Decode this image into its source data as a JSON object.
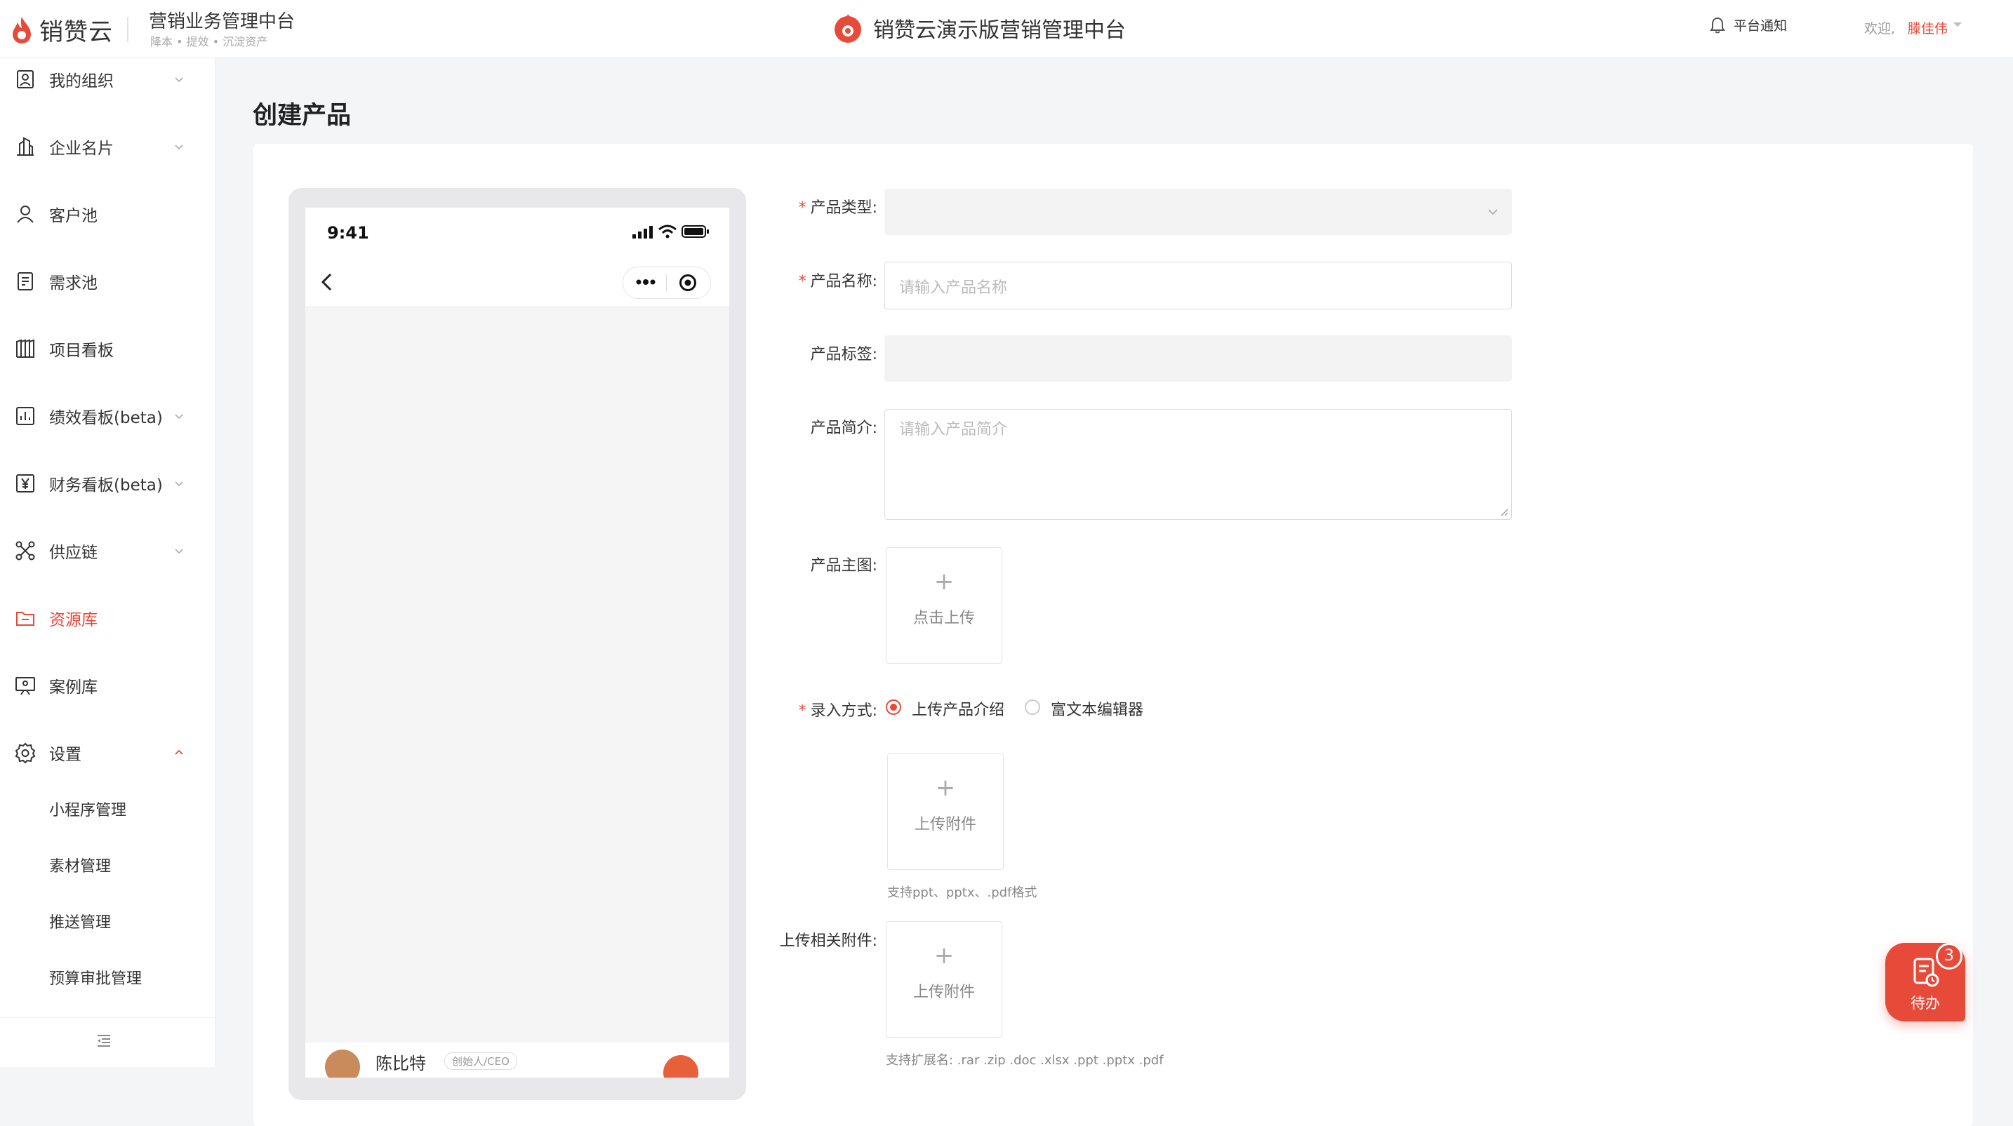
{
  "header": {
    "logo_text": "销赞云",
    "system_title": "营销业务管理中台",
    "system_subtitle": "降本 • 提效 • 沉淀资产",
    "center_title": "销赞云演示版营销管理中台",
    "notify_label": "平台通知",
    "welcome_label": "欢迎,",
    "username": "滕佳伟"
  },
  "sidebar": {
    "items": [
      {
        "label": "我的组织",
        "icon": "org-icon",
        "expandable": true
      },
      {
        "label": "企业名片",
        "icon": "building-icon",
        "expandable": true
      },
      {
        "label": "客户池",
        "icon": "user-icon",
        "expandable": false
      },
      {
        "label": "需求池",
        "icon": "document-icon",
        "expandable": false
      },
      {
        "label": "项目看板",
        "icon": "board-icon",
        "expandable": false
      },
      {
        "label": "绩效看板(beta)",
        "icon": "bar-chart-icon",
        "expandable": true
      },
      {
        "label": "财务看板(beta)",
        "icon": "yen-icon",
        "expandable": true
      },
      {
        "label": "供应链",
        "icon": "network-icon",
        "expandable": true
      },
      {
        "label": "资源库",
        "icon": "folder-icon",
        "expandable": false,
        "active": true
      },
      {
        "label": "案例库",
        "icon": "presentation-icon",
        "expandable": false
      },
      {
        "label": "设置",
        "icon": "gear-icon",
        "expandable": true,
        "expanded": true
      }
    ],
    "sub_items": [
      "小程序管理",
      "素材管理",
      "推送管理",
      "预算审批管理"
    ]
  },
  "main": {
    "page_title": "创建产品"
  },
  "phone_preview": {
    "time": "9:41",
    "author_name": "陈比特",
    "author_tag": "创始人/CEO"
  },
  "form": {
    "product_type_label": "产品类型:",
    "product_name_label": "产品名称:",
    "product_name_placeholder": "请输入产品名称",
    "product_tags_label": "产品标签:",
    "product_intro_label": "产品简介:",
    "product_intro_placeholder": "请输入产品简介",
    "main_image_label": "产品主图:",
    "main_image_upload": "点击上传",
    "entry_mode_label": "录入方式:",
    "entry_mode_options": [
      "上传产品介绍",
      "富文本编辑器"
    ],
    "entry_mode_selected": "上传产品介绍",
    "intro_upload_label": "上传附件",
    "intro_upload_hint": "支持ppt、pptx、.pdf格式",
    "related_upload_label": "上传相关附件:",
    "related_upload_button": "上传附件",
    "related_upload_hint": "支持扩展名: .rar .zip .doc .xlsx .ppt .pptx .pdf"
  },
  "todo": {
    "label": "待办",
    "count": "3"
  },
  "colors": {
    "accent": "#e84a3a",
    "page_bg": "#f4f5f7"
  }
}
